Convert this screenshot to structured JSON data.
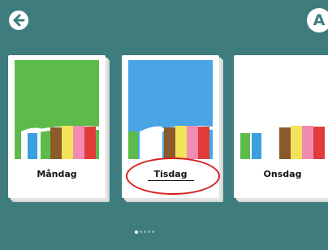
{
  "topbar": {
    "back_icon": "arrow-left-icon",
    "avatar_letter": "A"
  },
  "cards": [
    {
      "label": "Måndag",
      "color": "#5dbb4a"
    },
    {
      "label": "Tisdag",
      "color": "#4aa5e6",
      "selected": true
    },
    {
      "label": "Onsdag",
      "color": "#ffffff"
    }
  ],
  "pagination": {
    "total": 5,
    "active_index": 0
  },
  "colors": {
    "background": "#3e7c7d",
    "highlight_circle": "#d61f1f",
    "stripe_colors": [
      "#ffffff",
      "#3aa0e0",
      "#8a5a2b",
      "#f3e35a",
      "#f28bb3",
      "#e23b3b"
    ]
  }
}
